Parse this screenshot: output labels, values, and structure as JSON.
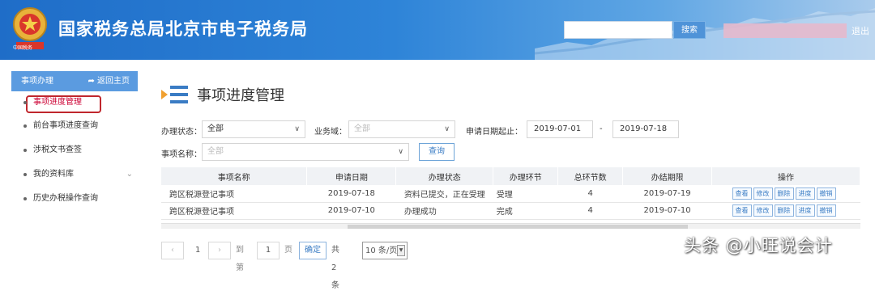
{
  "header": {
    "title": "国家税务总局北京市电子税务局",
    "search_label": "搜索",
    "logout_label": "退出",
    "emblem_caption": "中国税务"
  },
  "sidebar": {
    "head_label": "事项办理",
    "back_label": "返回主页",
    "items": [
      {
        "label": "事项进度管理"
      },
      {
        "label": "前台事项进度查询"
      },
      {
        "label": "涉税文书查签"
      },
      {
        "label": "我的资料库"
      },
      {
        "label": "历史办税操作查询"
      }
    ]
  },
  "main": {
    "title": "事项进度管理",
    "filters": {
      "status_label": "办理状态：",
      "status_value": "全部",
      "domain_label": "业务域：",
      "domain_placeholder": "全部",
      "date_label": "申请日期起止：",
      "date_from": "2019-07-01",
      "date_sep": "-",
      "date_to": "2019-07-18",
      "name_label": "事项名称：",
      "name_placeholder": "全部",
      "query_label": "查询"
    },
    "table": {
      "headers": [
        "事项名称",
        "申请日期",
        "办理状态",
        "办理环节",
        "总环节数",
        "办结期限",
        "操作"
      ],
      "rows": [
        {
          "name": "跨区税源登记事项",
          "date": "2019-07-18",
          "status": "资料已提交，正在受理",
          "step": "受理",
          "total": "4",
          "deadline": "2019-07-19"
        },
        {
          "name": "跨区税源登记事项",
          "date": "2019-07-10",
          "status": "办理成功",
          "step": "完成",
          "total": "4",
          "deadline": "2019-07-10"
        }
      ],
      "ops": [
        "查看",
        "修改",
        "删除",
        "进度",
        "撤销"
      ]
    },
    "pager": {
      "page": "1",
      "goto_label": "到第",
      "goto_value": "1",
      "page_unit": "页",
      "confirm_label": "确定",
      "total_label": "共 2 条",
      "size_label": "10 条/页"
    }
  },
  "watermark": "头条 @小旺说会计",
  "colors": {
    "header": "#2e84d8",
    "sidebar_head": "#5b9be0",
    "highlight": "#c0272d"
  }
}
